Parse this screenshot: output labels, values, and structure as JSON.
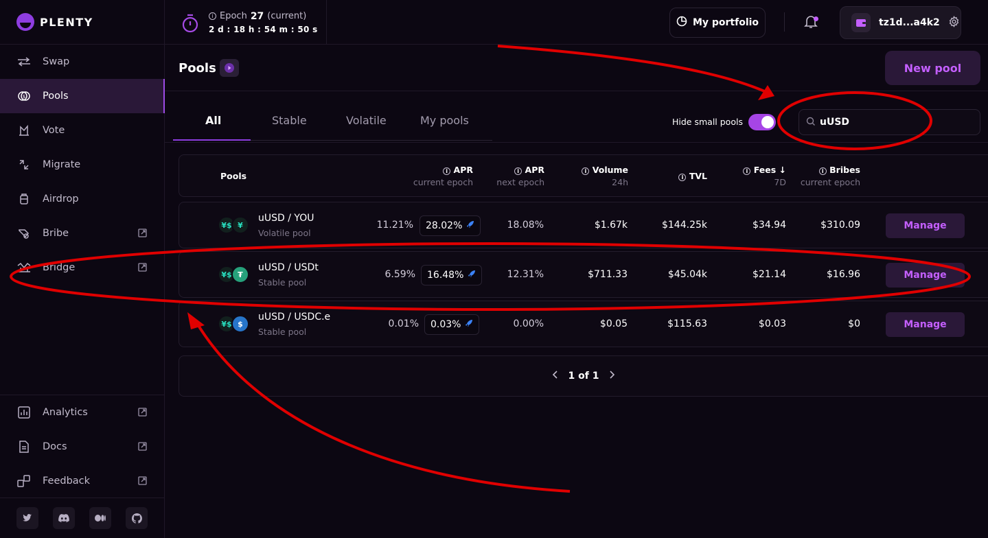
{
  "brand": {
    "name": "PLENTY"
  },
  "sidebar": {
    "items": [
      {
        "label": "Swap",
        "icon": "swap-icon",
        "external": false,
        "active": false
      },
      {
        "label": "Pools",
        "icon": "pools-icon",
        "external": false,
        "active": true
      },
      {
        "label": "Vote",
        "icon": "vote-icon",
        "external": false,
        "active": false
      },
      {
        "label": "Migrate",
        "icon": "migrate-icon",
        "external": false,
        "active": false
      },
      {
        "label": "Airdrop",
        "icon": "airdrop-icon",
        "external": false,
        "active": false
      },
      {
        "label": "Bribe",
        "icon": "bribe-icon",
        "external": true,
        "active": false
      },
      {
        "label": "Bridge",
        "icon": "bridge-icon",
        "external": true,
        "active": false
      }
    ],
    "bottom_items": [
      {
        "label": "Analytics",
        "icon": "analytics-icon",
        "external": true
      },
      {
        "label": "Docs",
        "icon": "docs-icon",
        "external": true
      },
      {
        "label": "Feedback",
        "icon": "feedback-icon",
        "external": true
      }
    ],
    "socials": [
      "twitter-icon",
      "discord-icon",
      "medium-icon",
      "github-icon"
    ]
  },
  "header": {
    "epoch_label": "Epoch",
    "epoch_number": "27",
    "epoch_status": "(current)",
    "countdown": "2 d : 18 h : 54 m : 50 s",
    "portfolio_label": "My portfolio",
    "wallet_address": "tz1d...a4k2"
  },
  "page": {
    "title": "Pools",
    "new_pool_label": "New pool"
  },
  "tabs": [
    "All",
    "Stable",
    "Volatile",
    "My pools"
  ],
  "filters": {
    "hide_small_label": "Hide small pools",
    "hide_small_enabled": true,
    "search_value": "uUSD"
  },
  "table": {
    "columns": [
      {
        "title": "Pools",
        "sub": ""
      },
      {
        "title": "APR",
        "sub": "current epoch"
      },
      {
        "title": "APR",
        "sub": "next epoch"
      },
      {
        "title": "Volume",
        "sub": "24h"
      },
      {
        "title": "TVL",
        "sub": ""
      },
      {
        "title": "Fees ↓",
        "sub": "7D"
      },
      {
        "title": "Bribes",
        "sub": "current epoch"
      }
    ],
    "rows": [
      {
        "pair": "uUSD / YOU",
        "type": "Volatile pool",
        "apr_current": "11.21%",
        "apr_boosted": "28.02%",
        "apr_next": "18.08%",
        "volume": "$1.67k",
        "tvl": "$144.25k",
        "fees": "$34.94",
        "bribes": "$310.09",
        "action": "Manage"
      },
      {
        "pair": "uUSD / USDt",
        "type": "Stable pool",
        "apr_current": "6.59%",
        "apr_boosted": "16.48%",
        "apr_next": "12.31%",
        "volume": "$711.33",
        "tvl": "$45.04k",
        "fees": "$21.14",
        "bribes": "$16.96",
        "action": "Manage"
      },
      {
        "pair": "uUSD / USDC.e",
        "type": "Stable pool",
        "apr_current": "0.01%",
        "apr_boosted": "0.03%",
        "apr_next": "0.00%",
        "volume": "$0.05",
        "tvl": "$115.63",
        "fees": "$0.03",
        "bribes": "$0",
        "action": "Manage"
      }
    ]
  },
  "pagination": {
    "label": "1 of 1"
  },
  "colors": {
    "accent": "#a645e6",
    "annotation": "#e00000",
    "background": "#0c0712"
  }
}
